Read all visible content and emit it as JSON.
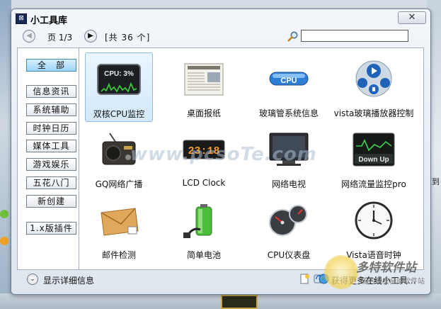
{
  "window": {
    "title": "小工具库",
    "close_glyph": "✕"
  },
  "nav": {
    "prev_glyph": "◀",
    "next_glyph": "▶",
    "page_label": "页 1/3",
    "count_label": "[共 36 个]",
    "search_value": ""
  },
  "categories": [
    {
      "label": "全　部",
      "active": true
    },
    {
      "label": "信息资讯"
    },
    {
      "label": "系统辅助"
    },
    {
      "label": "时钟日历"
    },
    {
      "label": "媒体工具"
    },
    {
      "label": "游戏娱乐"
    },
    {
      "label": "五花八门"
    },
    {
      "label": "新创建"
    },
    {
      "label": "1.x版插件"
    }
  ],
  "gadgets": [
    {
      "label": "双核CPU监控",
      "icon": "cpu-meter-icon",
      "thumb_text": "CPU: 3%",
      "selected": true
    },
    {
      "label": "桌面报纸",
      "icon": "newspaper-icon"
    },
    {
      "label": "玻璃管系统信息",
      "icon": "glass-tube-cpu-icon",
      "thumb_text": "CPU"
    },
    {
      "label": "vista玻璃播放器控制",
      "icon": "media-player-icon"
    },
    {
      "label": "GQ网络广播",
      "icon": "radio-icon"
    },
    {
      "label": "LCD Clock",
      "icon": "lcd-clock-icon",
      "thumb_text": "23:18"
    },
    {
      "label": "网络电视",
      "icon": "tv-monitor-icon"
    },
    {
      "label": "网络流量监控pro",
      "icon": "traffic-monitor-icon",
      "thumb_text": "Down Up"
    },
    {
      "label": "邮件检测",
      "icon": "mail-envelope-icon"
    },
    {
      "label": "简单电池",
      "icon": "battery-icon"
    },
    {
      "label": "CPU仪表盘",
      "icon": "cpu-gauge-icon"
    },
    {
      "label": "Vista语音时钟",
      "icon": "analog-clock-icon"
    }
  ],
  "footer": {
    "details_glyph": "⌄",
    "details_label": "显示详细信息",
    "online_label": "获得更多在线小工具..."
  },
  "overlay": {
    "watermark": "www.pcsoTe.com",
    "logo_text": "多特软件站",
    "logo_sub": "国内最安全的软件站",
    "side_text": "库到"
  },
  "colors": {
    "accent_selected": "#9fd4f7",
    "window_border": "#6d7f92"
  }
}
